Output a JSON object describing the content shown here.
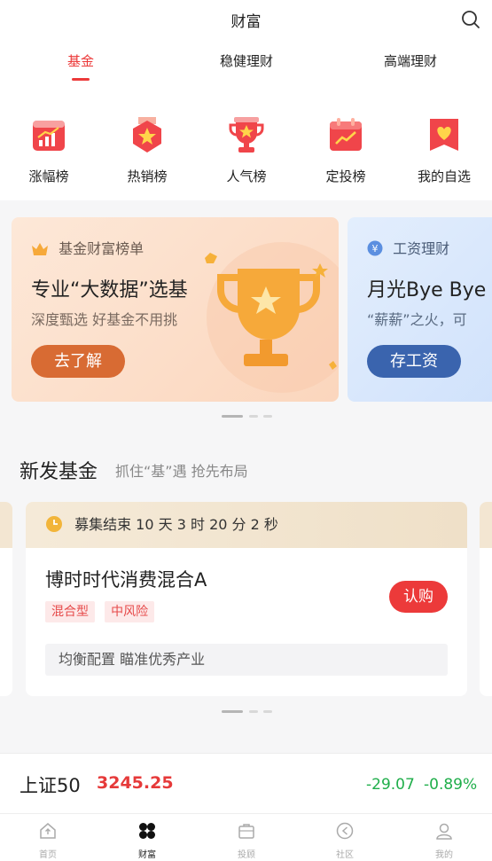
{
  "header": {
    "title": "财富"
  },
  "tabs": [
    {
      "label": "基金",
      "active": true
    },
    {
      "label": "稳健理财",
      "active": false
    },
    {
      "label": "高端理财",
      "active": false
    }
  ],
  "quick_links": [
    {
      "label": "涨幅榜",
      "icon": "trend-chart-icon"
    },
    {
      "label": "热销榜",
      "icon": "star-badge-icon"
    },
    {
      "label": "人气榜",
      "icon": "trophy-icon"
    },
    {
      "label": "定投榜",
      "icon": "calendar-chart-icon"
    },
    {
      "label": "我的自选",
      "icon": "heart-bookmark-icon"
    }
  ],
  "banners": [
    {
      "tag": "基金财富榜单",
      "title": "专业“大数据”选基",
      "subtitle": "深度甄选 好基金不用挑",
      "button": "去了解"
    },
    {
      "tag": "工资理财",
      "title": "月光Bye Bye",
      "subtitle": "“薪薪”之火，可",
      "button": "存工资"
    }
  ],
  "new_funds": {
    "title": "新发基金",
    "subtitle": "抓住“基”遇 抢先布局",
    "card": {
      "countdown": "募集结束 10 天 3 时 20 分 2 秒",
      "fund_name": "博时时代消费混合A",
      "tags": [
        "混合型",
        "中风险"
      ],
      "button": "认购",
      "description": "均衡配置 瞄准优秀产业"
    }
  },
  "index": {
    "name": "上证50",
    "value": "3245.25",
    "change": "-29.07",
    "change_pct": "-0.89%"
  },
  "tabbar": [
    {
      "label": "首页",
      "active": false
    },
    {
      "label": "财富",
      "active": true
    },
    {
      "label": "投顾",
      "active": false
    },
    {
      "label": "社区",
      "active": false
    },
    {
      "label": "我的",
      "active": false
    }
  ],
  "colors": {
    "accent": "#ec3a3a",
    "down": "#1fae4a",
    "banner_btn_1": "#d86b33",
    "banner_btn_2": "#3a64ae"
  }
}
